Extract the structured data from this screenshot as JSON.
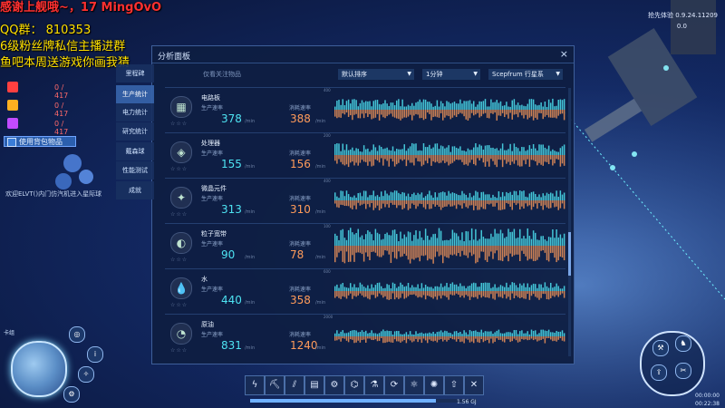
{
  "overlay": {
    "line1": "感谢上舰哦~，17  MingOvO",
    "line2": "QQ群：  810353",
    "line3": "6级粉丝牌私信主播进群",
    "line4": "鱼吧本周送游戏你画我猜"
  },
  "resources": [
    {
      "color": "#ff4040",
      "value": "0 / 417"
    },
    {
      "color": "#ffb020",
      "value": "0 / 417"
    },
    {
      "color": "#c24bff",
      "value": "0 / 417"
    }
  ],
  "use_stock_label": "使用背包物品",
  "welcome_text": "欢迎ELVT()内门仿汽机进入星际球",
  "version": {
    "line1": "抢先体验 0.9.24.11209",
    "line2": "0.0"
  },
  "panel": {
    "title": "分析面板",
    "close": "×",
    "tabs": [
      "里程碑",
      "生产统计",
      "电力统计",
      "研究统计",
      "戴森球",
      "性能测试",
      "成就"
    ],
    "active_tab": 1,
    "filter_placeholder": "仅看关注物品",
    "sort": "默认排序",
    "interval": "1分钟",
    "scope": "Scepfrum 行星系",
    "prod_label": "生产速率",
    "cons_label": "消耗速率",
    "unit": "/min",
    "items": [
      {
        "name": "电路板",
        "icon": "circuit-board-icon",
        "glyph": "▦",
        "production": "378",
        "consumption": "388",
        "scale": "400",
        "density": 0.55
      },
      {
        "name": "处理器",
        "icon": "processor-icon",
        "glyph": "◈",
        "production": "155",
        "consumption": "156",
        "scale": "200",
        "density": 0.6
      },
      {
        "name": "微晶元件",
        "icon": "microcrystal-icon",
        "glyph": "✦",
        "production": "313",
        "consumption": "310",
        "scale": "400",
        "density": 0.5
      },
      {
        "name": "粒子宽带",
        "icon": "particle-broadband-icon",
        "glyph": "◐",
        "production": "90",
        "consumption": "78",
        "scale": "100",
        "density": 0.9
      },
      {
        "name": "水",
        "icon": "water-icon",
        "glyph": "💧",
        "production": "440",
        "consumption": "358",
        "scale": "600",
        "density": 0.45
      },
      {
        "name": "原油",
        "icon": "crude-oil-icon",
        "glyph": "◔",
        "production": "831",
        "consumption": "1240",
        "scale": "2000",
        "density": 0.35
      }
    ]
  },
  "toolbar": [
    {
      "name": "power-icon",
      "glyph": "ϟ"
    },
    {
      "name": "mining-icon",
      "glyph": "⛏"
    },
    {
      "name": "conveyor-icon",
      "glyph": "⫽"
    },
    {
      "name": "storage-icon",
      "glyph": "▤"
    },
    {
      "name": "assembler-icon",
      "glyph": "⚙"
    },
    {
      "name": "refine-icon",
      "glyph": "⌬"
    },
    {
      "name": "lab-icon",
      "glyph": "⚗"
    },
    {
      "name": "logistics-icon",
      "glyph": "⟳"
    },
    {
      "name": "chemical-icon",
      "glyph": "⚛"
    },
    {
      "name": "dyson-icon",
      "glyph": "✺"
    },
    {
      "name": "launch-icon",
      "glyph": "⇧"
    },
    {
      "name": "dismantle-icon",
      "glyph": "✕"
    }
  ],
  "power": {
    "fill_fraction": 0.82,
    "text": "1.56 GJ"
  },
  "planet_name": "卡组",
  "clock": {
    "line1": "00:00:00",
    "line2": "00:22:38"
  }
}
